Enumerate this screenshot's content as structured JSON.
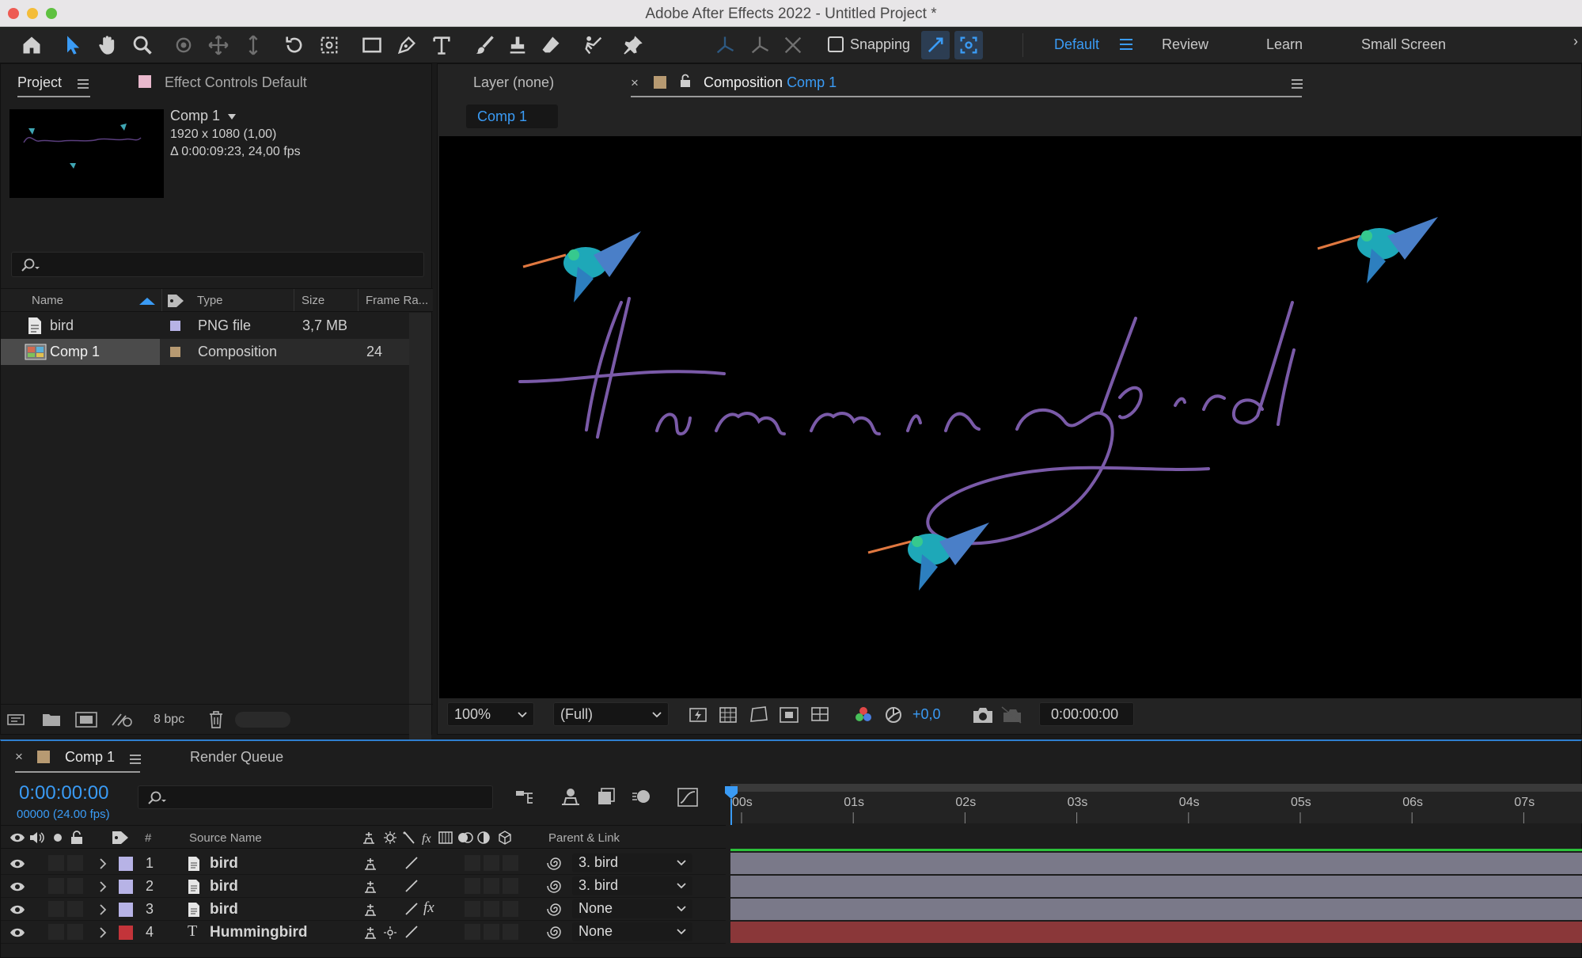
{
  "window": {
    "title": "Adobe After Effects 2022 - Untitled Project *"
  },
  "toolbar": {
    "snapping_label": "Snapping",
    "workspaces": [
      "Default",
      "Review",
      "Learn",
      "Small Screen"
    ],
    "active_workspace": "Default"
  },
  "project_panel": {
    "tab_project": "Project",
    "tab_effect_controls": "Effect Controls Default",
    "comp_name": "Comp 1",
    "comp_resolution": "1920 x 1080 (1,00)",
    "comp_duration": "Δ 0:00:09:23, 24,00 fps",
    "search_placeholder": "",
    "columns": [
      "Name",
      "Type",
      "Size",
      "Frame Ra..."
    ],
    "items": [
      {
        "name": "bird",
        "type": "PNG file",
        "size": "3,7 MB",
        "frame_rate": "",
        "label_color": "#b7b3e6"
      },
      {
        "name": "Comp 1",
        "type": "Composition",
        "size": "",
        "frame_rate": "24",
        "label_color": "#b79a72"
      }
    ],
    "bpc": "8 bpc"
  },
  "viewer": {
    "tab_layer": "Layer (none)",
    "tab_composition_prefix": "Composition",
    "tab_composition_name": "Comp 1",
    "breadcrumb": "Comp 1",
    "canvas_text": "Hummingbird",
    "zoom": "100%",
    "resolution": "(Full)",
    "exposure": "+0,0",
    "timecode": "0:00:00:00"
  },
  "timeline": {
    "tab_comp": "Comp 1",
    "tab_render_queue": "Render Queue",
    "current_time": "0:00:00:00",
    "frame_info": "00000 (24.00 fps)",
    "col_hash": "#",
    "col_source_name": "Source Name",
    "col_parent_link": "Parent & Link",
    "ruler_labels": [
      "00s",
      "01s",
      "02s",
      "03s",
      "04s",
      "05s",
      "06s",
      "07s"
    ],
    "layers": [
      {
        "index": "1",
        "name": "bird",
        "kind": "file",
        "parent": "3. bird",
        "label_color": "#b7b3e6",
        "bar_color": "#7a7989",
        "fx": false
      },
      {
        "index": "2",
        "name": "bird",
        "kind": "file",
        "parent": "3. bird",
        "label_color": "#b7b3e6",
        "bar_color": "#7a7989",
        "fx": false
      },
      {
        "index": "3",
        "name": "bird",
        "kind": "file",
        "parent": "None",
        "label_color": "#b7b3e6",
        "bar_color": "#7a7989",
        "fx": true
      },
      {
        "index": "4",
        "name": "Hummingbird",
        "kind": "text",
        "parent": "None",
        "label_color": "#c3343a",
        "bar_color": "#8a3739",
        "fx": false
      }
    ]
  },
  "colors": {
    "accent": "#3a9bf5",
    "text_purple": "#7a5aa8",
    "work_area_green": "#2bc13a"
  }
}
